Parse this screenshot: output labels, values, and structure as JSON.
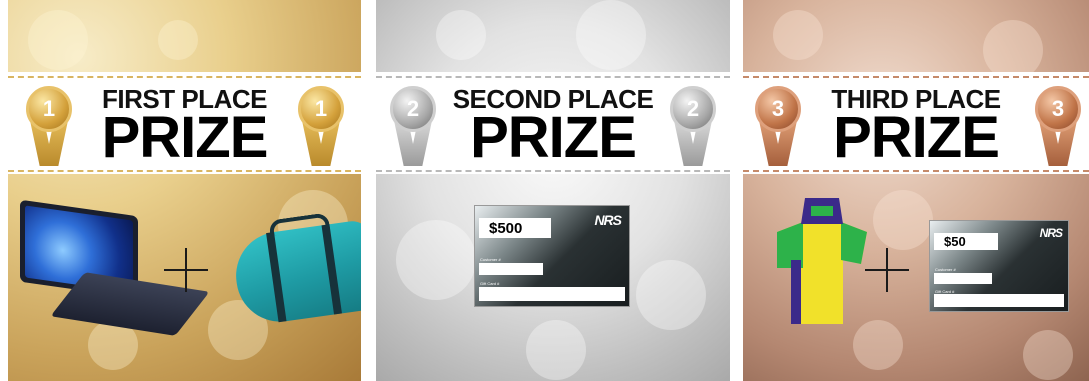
{
  "panels": [
    {
      "place": "FIRST PLACE",
      "prize": "PRIZE",
      "badge_number": "1",
      "medal": "gold",
      "items": [
        "laptop",
        "duffel-bag"
      ]
    },
    {
      "place": "SECOND PLACE",
      "prize": "PRIZE",
      "badge_number": "2",
      "medal": "silver",
      "items": [
        "gift-card"
      ],
      "gift_card": {
        "amount": "$500",
        "brand": "NRS",
        "customer_label": "Customer #",
        "gift_card_label": "Gift Card #"
      }
    },
    {
      "place": "THIRD PLACE",
      "prize": "PRIZE",
      "badge_number": "3",
      "medal": "bronze",
      "items": [
        "changing-poncho",
        "gift-card"
      ],
      "gift_card": {
        "amount": "$50",
        "brand": "NRS",
        "customer_label": "Customer #",
        "gift_card_label": "Gift Card #"
      }
    }
  ],
  "colors": {
    "gold": "#d4a13b",
    "silver": "#a9a9a9",
    "bronze": "#c07448",
    "text": "#000000"
  }
}
